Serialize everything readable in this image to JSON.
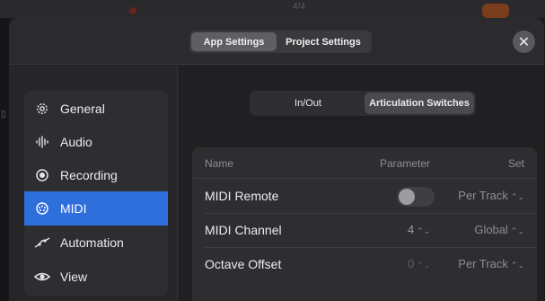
{
  "background": {
    "position_label": "4/4"
  },
  "header": {
    "tabs": [
      {
        "label": "App Settings",
        "active": true
      },
      {
        "label": "Project Settings",
        "active": false
      }
    ],
    "close_icon": "close-icon"
  },
  "sidebar": {
    "items": [
      {
        "label": "General",
        "icon": "gear-icon",
        "active": false
      },
      {
        "label": "Audio",
        "icon": "waveform-icon",
        "active": false
      },
      {
        "label": "Recording",
        "icon": "record-icon",
        "active": false
      },
      {
        "label": "MIDI",
        "icon": "midi-icon",
        "active": true
      },
      {
        "label": "Automation",
        "icon": "automation-icon",
        "active": false
      },
      {
        "label": "View",
        "icon": "eye-icon",
        "active": false
      }
    ]
  },
  "content": {
    "tabs": [
      {
        "label": "In/Out",
        "active": false
      },
      {
        "label": "Articulation Switches",
        "active": true
      }
    ],
    "table": {
      "headers": {
        "name": "Name",
        "parameter": "Parameter",
        "set": "Set"
      },
      "rows": [
        {
          "name": "MIDI Remote",
          "parameter": "",
          "toggle_on": false,
          "set": "Per Track"
        },
        {
          "name": "MIDI Channel",
          "parameter": "4",
          "set": "Global"
        },
        {
          "name": "Octave Offset",
          "parameter": "0",
          "set": "Per Track"
        }
      ]
    }
  },
  "colors": {
    "accent": "#2f6fdc",
    "sheet_background": "#232325",
    "panel_background": "#2e2e31"
  }
}
